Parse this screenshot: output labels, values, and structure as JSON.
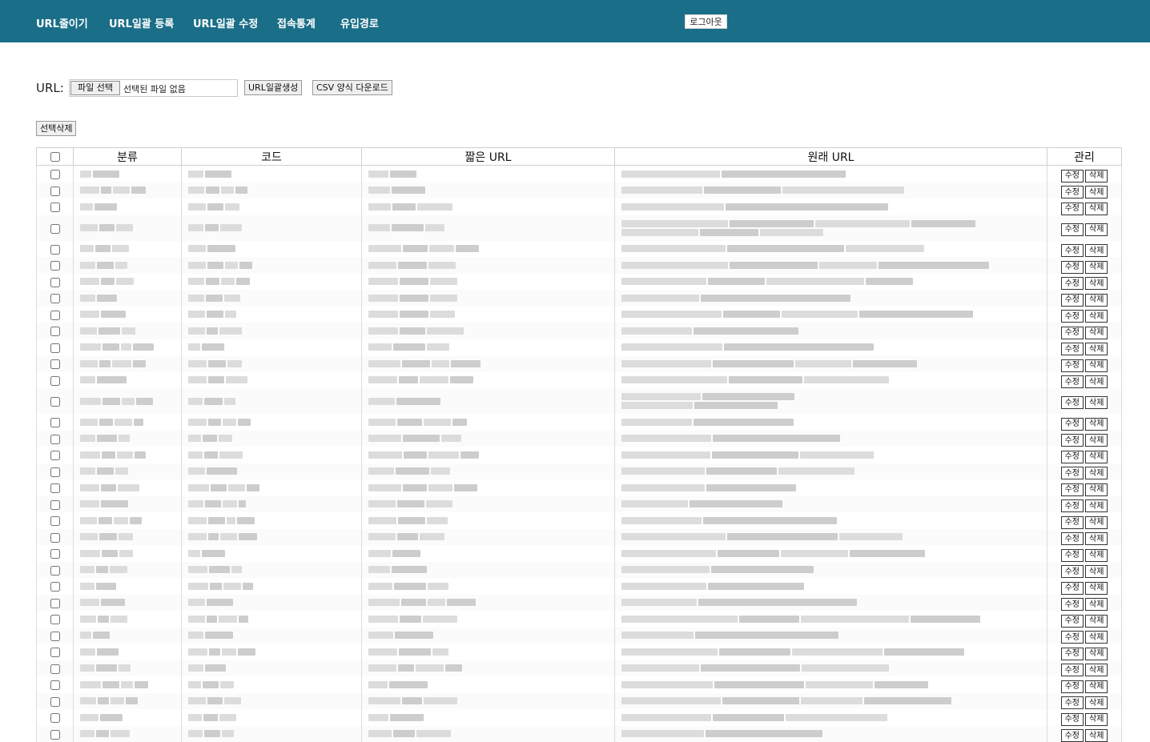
{
  "nav": {
    "items": [
      {
        "label": "URL줄이기"
      },
      {
        "label": "URL일괄 등록"
      },
      {
        "label": "URL일괄 수정"
      },
      {
        "label": "접속통계"
      },
      {
        "label": "유입경로"
      }
    ],
    "logout_label": "로그아웃"
  },
  "upload": {
    "label": "URL:",
    "file_button_label": "파일 선택",
    "file_status": "선택된 파일 없음",
    "generate_label": "URL일괄생성",
    "csv_label": "CSV 양식 다운로드"
  },
  "delete_selected_label": "선택삭제",
  "table": {
    "headers": [
      "분류",
      "코드",
      "짧은 URL",
      "원래 URL",
      "관리"
    ],
    "edit_label": "수정",
    "delete_label": "삭제",
    "rows": [
      {
        "lines": 1
      },
      {
        "lines": 1
      },
      {
        "lines": 1
      },
      {
        "lines": 2
      },
      {
        "lines": 1
      },
      {
        "lines": 1
      },
      {
        "lines": 1
      },
      {
        "lines": 1
      },
      {
        "lines": 1
      },
      {
        "lines": 1
      },
      {
        "lines": 1
      },
      {
        "lines": 1
      },
      {
        "lines": 1
      },
      {
        "lines": 2
      },
      {
        "lines": 1
      },
      {
        "lines": 1
      },
      {
        "lines": 1
      },
      {
        "lines": 1
      },
      {
        "lines": 1
      },
      {
        "lines": 1
      },
      {
        "lines": 1
      },
      {
        "lines": 1
      },
      {
        "lines": 1
      },
      {
        "lines": 1
      },
      {
        "lines": 1
      },
      {
        "lines": 1
      },
      {
        "lines": 1
      },
      {
        "lines": 1
      },
      {
        "lines": 1
      },
      {
        "lines": 1
      },
      {
        "lines": 1
      },
      {
        "lines": 1
      },
      {
        "lines": 1
      },
      {
        "lines": 1
      }
    ]
  },
  "colors": {
    "header_bar": "#1a6e87",
    "redacted": "#dcdcdc"
  }
}
